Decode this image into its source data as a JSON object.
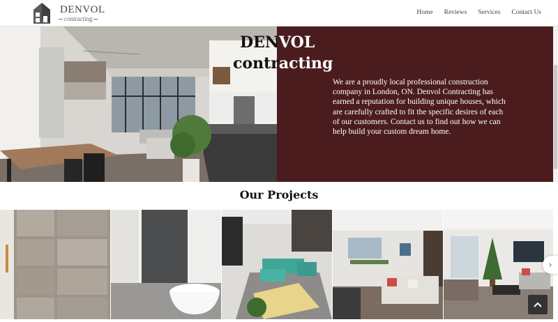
{
  "brand": {
    "name": "DENVOL",
    "tagline": "contracting"
  },
  "nav": {
    "items": [
      "Home",
      "Reviews",
      "Services",
      "Contact Us"
    ]
  },
  "hero": {
    "title_line1": "DENVOL",
    "title_line2": "contracting",
    "title_line1_parts": [
      "DEN",
      "VOL"
    ],
    "title_line2_parts": [
      "contr",
      "acting"
    ],
    "description": "We are a proudly local professional construction company in London, ON. Denvol Contracting has earned a reputation for building unique houses, which are carefully crafted to fit the specific desires of each of our customers. Contact us to find out how we can help build your custom dream home.",
    "panel_color": "#4b1c1e"
  },
  "projects": {
    "heading": "Our Projects"
  },
  "icons": {
    "logo": "house-logo-icon",
    "next": "chevron-right-icon",
    "back_to_top": "chevron-up-icon"
  }
}
